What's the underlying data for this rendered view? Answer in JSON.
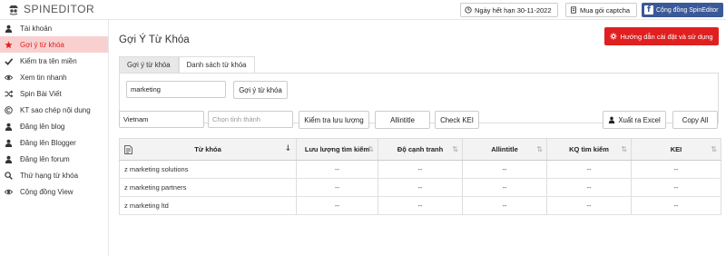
{
  "app": {
    "logo_text": "SPINEDITOR"
  },
  "topbar": {
    "expiry_label": "Ngày hết hạn 30-11-2022",
    "captcha_label": "Mua gói captcha",
    "community_label": "Cộng đồng SpinEditor"
  },
  "sidebar": {
    "items": [
      {
        "label": "Tài khoản",
        "icon": "user-icon"
      },
      {
        "label": "Gợi ý từ khóa",
        "icon": "star-icon",
        "active": true
      },
      {
        "label": "Kiểm tra tên miền",
        "icon": "check-icon"
      },
      {
        "label": "Xem tin nhanh",
        "icon": "eye-icon"
      },
      {
        "label": "Spin Bài Viết",
        "icon": "shuffle-icon"
      },
      {
        "label": "KT sao chép nội dung",
        "icon": "copyright-icon"
      },
      {
        "label": "Đăng lên blog",
        "icon": "user-icon"
      },
      {
        "label": "Đăng lên Blogger",
        "icon": "user-icon"
      },
      {
        "label": "Đăng lên forum",
        "icon": "user-icon"
      },
      {
        "label": "Thứ hạng từ khóa",
        "icon": "search-icon"
      },
      {
        "label": "Cộng đồng View",
        "icon": "eye-icon"
      }
    ]
  },
  "main": {
    "title": "Gợi Ý Từ Khóa",
    "guide_button": "Hướng dẫn cài đặt và sử dụng",
    "tabs": [
      {
        "label": "Gợi ý từ khóa",
        "active": true
      },
      {
        "label": "Danh sách từ khóa",
        "active": false
      }
    ],
    "keyword_input_value": "marketing",
    "suggest_button": "Gợi ý từ khóa",
    "country_value": "Vietnam",
    "province_placeholder": "Chọn tỉnh thành",
    "traffic_button": "Kiểm tra lưu lượng",
    "allintitle_button": "Allintitle",
    "kei_button": "Check KEI",
    "export_button": "Xuất ra Excel",
    "copy_button": "Copy All"
  },
  "table": {
    "headers": [
      "Từ khóa",
      "Lưu lượng tìm kiếm",
      "Độ cạnh tranh",
      "Allintitle",
      "KQ tìm kiếm",
      "KEI"
    ],
    "rows": [
      [
        "z marketing solutions",
        "--",
        "--",
        "--",
        "--",
        "--"
      ],
      [
        "z marketing partners",
        "--",
        "--",
        "--",
        "--",
        "--"
      ],
      [
        "z marketing ltd",
        "--",
        "--",
        "--",
        "--",
        "--"
      ]
    ]
  },
  "colors": {
    "accent": "#e02020",
    "active_bg": "#f8d0d0",
    "facebook": "#3b5998"
  }
}
